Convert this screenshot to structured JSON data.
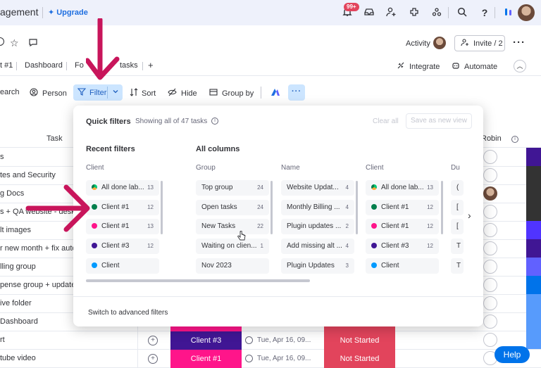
{
  "topbar": {
    "app_title": "agement",
    "upgrade_label": "Upgrade",
    "notifications_badge": "99+"
  },
  "board_header": {
    "activity_label": "Activity",
    "invite_label": "Invite / 2"
  },
  "tabs": {
    "items": [
      {
        "label": "t #1"
      },
      {
        "label": "Dashboard"
      },
      {
        "label": "Fo"
      },
      {
        "label": "tasks"
      }
    ],
    "add_label": "+",
    "integrate_label": "Integrate",
    "automate_label": "Automate"
  },
  "toolbar": {
    "search_label": "earch",
    "person_label": "Person",
    "filter_label": "Filter",
    "sort_label": "Sort",
    "hide_label": "Hide",
    "group_by_label": "Group by"
  },
  "table": {
    "task_header": "Task",
    "robin_header": "Robin",
    "rows": [
      {
        "task": "s"
      },
      {
        "task": "tes and Security"
      },
      {
        "task": "g Docs"
      },
      {
        "task": "s + QA website - deskt"
      },
      {
        "task": "lt images"
      },
      {
        "task": "r new month + fix autor"
      },
      {
        "task": "lling group"
      },
      {
        "task": "pense group + update"
      },
      {
        "task": "ive folder"
      },
      {
        "task": "Dashboard"
      },
      {
        "task": "rt",
        "client": "Client #3",
        "date": "Tue, Apr 16, 09...",
        "status": "Not Started"
      },
      {
        "task": "tube video",
        "client": "Client #1",
        "date": "Tue, Apr 16, 09...",
        "status": "Not Started"
      }
    ]
  },
  "help_label": "Help",
  "filter_panel": {
    "title": "Quick filters",
    "count_text": "Showing all of 47 tasks",
    "clear_all": "Clear all",
    "save_view": "Save as new view",
    "recent_title": "Recent filters",
    "all_columns_title": "All columns",
    "recent_column": {
      "title": "Client",
      "chips": [
        {
          "label": "All done lab...",
          "count": "13"
        },
        {
          "label": "Client #1",
          "count": "12"
        },
        {
          "label": "Client #1",
          "count": "13"
        },
        {
          "label": "Client #3",
          "count": "12"
        },
        {
          "label": "Client",
          "count": ""
        }
      ]
    },
    "group_column": {
      "title": "Group",
      "chips": [
        {
          "label": "Top group",
          "count": "24"
        },
        {
          "label": "Open tasks",
          "count": "24"
        },
        {
          "label": "New Tasks",
          "count": "22"
        },
        {
          "label": "Waiting on clien...",
          "count": "1"
        },
        {
          "label": "Nov 2023",
          "count": ""
        }
      ]
    },
    "name_column": {
      "title": "Name",
      "chips": [
        {
          "label": "Website Updat...",
          "count": "4"
        },
        {
          "label": "Monthly Billing ...",
          "count": "4"
        },
        {
          "label": "Plugin updates ...",
          "count": "2"
        },
        {
          "label": "Add missing alt ...",
          "count": "4"
        },
        {
          "label": "Plugin Updates",
          "count": "3"
        }
      ]
    },
    "client_column": {
      "title": "Client",
      "chips": [
        {
          "label": "All done lab...",
          "count": "13"
        },
        {
          "label": "Client #1",
          "count": "12"
        },
        {
          "label": "Client #1",
          "count": "12"
        },
        {
          "label": "Client #3",
          "count": "12"
        },
        {
          "label": "Client",
          "count": ""
        }
      ]
    },
    "due_column": {
      "title": "Du",
      "chips": [
        {
          "label": "("
        },
        {
          "label": "["
        },
        {
          "label": "["
        },
        {
          "label": "T"
        },
        {
          "label": "T"
        }
      ]
    },
    "advanced_link": "Switch to advanced filters"
  },
  "colors": {
    "accent": "#0073ea",
    "client1_dark_green": "#037f4c",
    "client1_pink": "#ff158a",
    "client3_purple": "#401694",
    "client_teal": "#009aff",
    "not_started": "#e2445c",
    "annotation_arrow": "#c8155b"
  },
  "icons": [
    "sparkle-icon",
    "bell-icon",
    "inbox-icon",
    "invite-person-icon",
    "apps-icon",
    "integrations-icon",
    "search-icon",
    "help-icon",
    "monday-logo-icon",
    "star-icon",
    "chat-icon",
    "integrate-icon",
    "automate-icon",
    "person-icon",
    "filter-icon",
    "sort-icon",
    "eye-off-icon",
    "group-by-icon",
    "sidekick-icon",
    "more-icon",
    "info-icon",
    "chevron-right-icon",
    "add-update-icon"
  ]
}
